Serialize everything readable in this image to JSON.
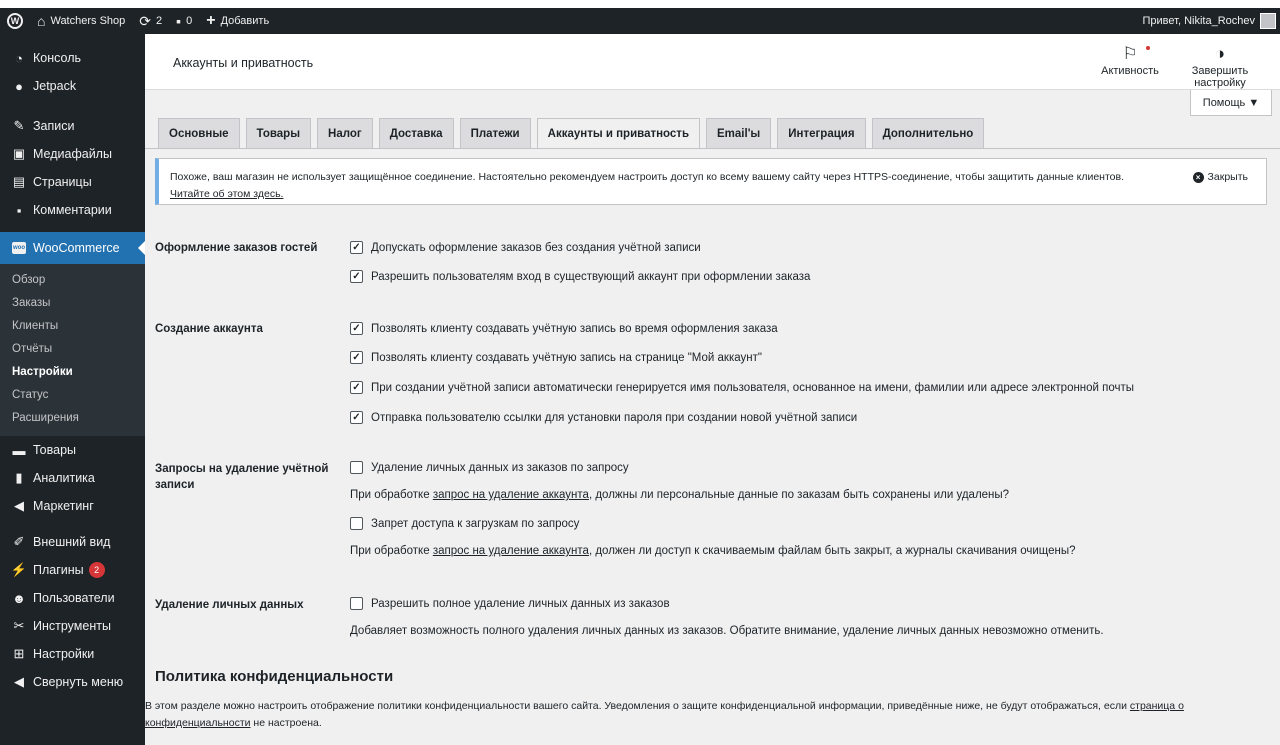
{
  "adminbar": {
    "site_name": "Watchers Shop",
    "updates_count": "2",
    "comments_count": "0",
    "add_new_label": "Добавить",
    "greeting": "Привет, Nikita_Rochev"
  },
  "sidebar": {
    "top_items": [
      {
        "label": "Консоль",
        "icon": "dashboard-icon"
      },
      {
        "label": "Jetpack",
        "icon": "jetpack-icon"
      },
      {
        "label": "Записи",
        "icon": "pin-icon"
      },
      {
        "label": "Медиафайлы",
        "icon": "media-icon"
      },
      {
        "label": "Страницы",
        "icon": "pages-icon"
      },
      {
        "label": "Комментарии",
        "icon": "comments-icon"
      }
    ],
    "woocommerce_label": "WooCommerce",
    "woo_logo_text": "woo",
    "submenu": [
      "Обзор",
      "Заказы",
      "Клиенты",
      "Отчёты",
      "Настройки",
      "Статус",
      "Расширения"
    ],
    "bottom_items": [
      {
        "label": "Товары",
        "icon": "products-icon"
      },
      {
        "label": "Аналитика",
        "icon": "analytics-icon"
      },
      {
        "label": "Маркетинг",
        "icon": "megaphone-icon"
      },
      {
        "label": "Внешний вид",
        "icon": "appearance-icon"
      },
      {
        "label": "Плагины",
        "icon": "plugins-icon",
        "badge": "2"
      },
      {
        "label": "Пользователи",
        "icon": "users-icon"
      },
      {
        "label": "Инструменты",
        "icon": "wrench-icon"
      },
      {
        "label": "Настройки",
        "icon": "settings-icon"
      },
      {
        "label": "Свернуть меню",
        "icon": "collapse-icon"
      }
    ]
  },
  "header": {
    "title": "Аккаунты и приватность",
    "activity_label": "Активность",
    "finish_setup_label": "Завершить настройку"
  },
  "help_label": "Помощь ▼",
  "tabs": [
    "Основные",
    "Товары",
    "Налог",
    "Доставка",
    "Платежи",
    "Аккаунты и приватность",
    "Email'ы",
    "Интеграция",
    "Дополнительно"
  ],
  "active_tab": "Аккаунты и приватность",
  "notice": {
    "text": "Похоже, ваш магазин не использует защищённое соединение. Настоятельно рекомендуем настроить доступ ко всему вашему сайту через HTTPS-соединение, чтобы защитить данные клиентов.",
    "link": "Читайте об этом здесь.",
    "dismiss": "Закрыть"
  },
  "guest_checkout": {
    "label": "Оформление заказов гостей",
    "opt1": "Допускать оформление заказов без создания учётной записи",
    "opt1_checked": true,
    "opt2": "Разрешить пользователям вход в существующий аккаунт при оформлении заказа",
    "opt2_checked": true
  },
  "account_creation": {
    "label": "Создание аккаунта",
    "opt1": "Позволять клиенту создавать учётную запись во время оформления заказа",
    "opt2": "Позволять клиенту создавать учётную запись на странице \"Мой аккаунт\"",
    "opt3": "При создании учётной записи автоматически генерируется имя пользователя, основанное на имени, фамилии или адресе электронной почты",
    "opt4": "Отправка пользователю ссылки для установки пароля при создании новой учётной записи"
  },
  "erasure": {
    "label": "Запросы на удаление учётной записи",
    "opt1": "Удаление личных данных из заказов по запросу",
    "desc1_before": "При обработке ",
    "desc1_link": "запрос на удаление аккаунта",
    "desc1_after": ", должны ли персональные данные по заказам быть сохранены или удалены?",
    "opt2": "Запрет доступа к загрузкам по запросу",
    "desc2_before": "При обработке ",
    "desc2_link": "запрос на удаление аккаунта",
    "desc2_after": ", должен ли доступ к скачиваемым файлам быть закрыт, а журналы скачивания очищены?"
  },
  "personal_data_removal": {
    "label": "Удаление личных данных",
    "opt1": "Разрешить полное удаление личных данных из заказов",
    "desc": "Добавляет возможность полного удаления личных данных из заказов. Обратите внимание, удаление личных данных невозможно отменить."
  },
  "privacy_policy": {
    "title": "Политика конфиденциальности",
    "text_before": "В этом разделе можно настроить отображение политики конфиденциальности вашего сайта. Уведомления о защите конфиденциальной информации, приведённые ниже, не будут отображаться, если ",
    "link": "страница о конфиденциальности",
    "text_after": " не настроена."
  }
}
